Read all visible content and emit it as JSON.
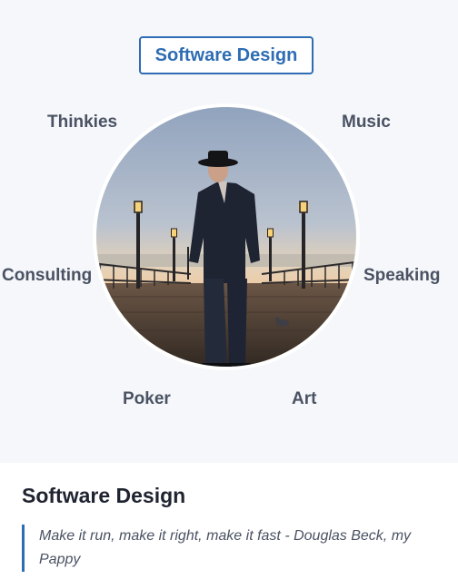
{
  "active_topic": "Software Design",
  "topics": {
    "thinkies": "Thinkies",
    "music": "Music",
    "consulting": "Consulting",
    "speaking": "Speaking",
    "poker": "Poker",
    "art": "Art"
  },
  "section": {
    "title": "Software Design",
    "quote": "Make it run, make it right, make it fast - Douglas Beck, my Pappy"
  },
  "colors": {
    "accent": "#2e6db4",
    "topic_text": "#4a5263",
    "hero_background": "#f5f7fa"
  }
}
